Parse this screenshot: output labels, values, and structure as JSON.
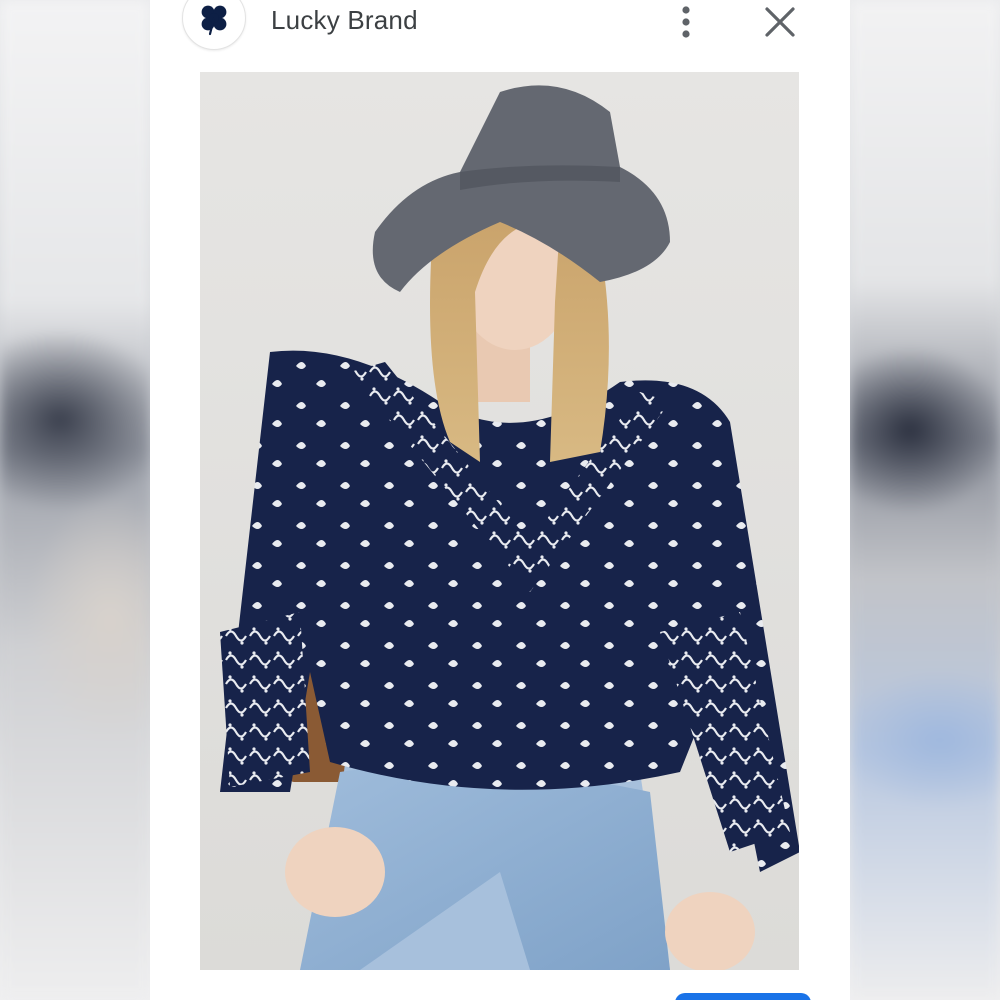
{
  "header": {
    "brand_name": "Lucky Brand",
    "logo_icon": "four-leaf-clover-icon",
    "more_icon": "more-vert-icon",
    "close_icon": "close-icon"
  },
  "image": {
    "subject_icon": "product-photo-bandana-sweater"
  },
  "colors": {
    "logo": "#0d1f45",
    "text": "#3c4043",
    "accent": "#1a73e8",
    "sweater": "#17234a",
    "denim": "#8fb0d2",
    "hat": "#636770"
  }
}
